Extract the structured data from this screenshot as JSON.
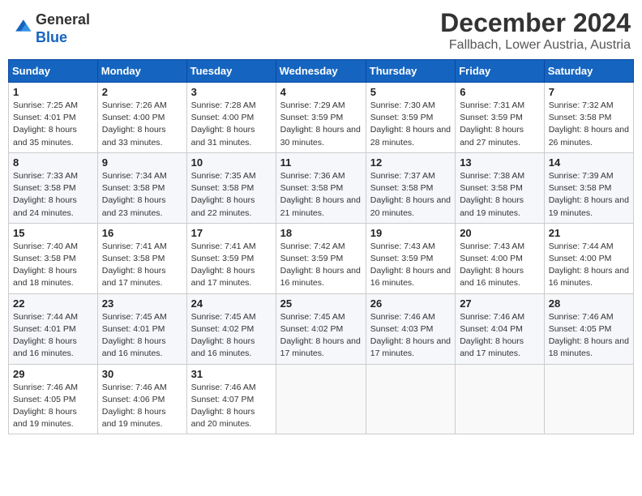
{
  "header": {
    "logo_line1": "General",
    "logo_line2": "Blue",
    "main_title": "December 2024",
    "subtitle": "Fallbach, Lower Austria, Austria"
  },
  "calendar": {
    "days_of_week": [
      "Sunday",
      "Monday",
      "Tuesday",
      "Wednesday",
      "Thursday",
      "Friday",
      "Saturday"
    ],
    "weeks": [
      [
        {
          "day": "1",
          "sunrise": "7:25 AM",
          "sunset": "4:01 PM",
          "daylight": "8 hours and 35 minutes."
        },
        {
          "day": "2",
          "sunrise": "7:26 AM",
          "sunset": "4:00 PM",
          "daylight": "8 hours and 33 minutes."
        },
        {
          "day": "3",
          "sunrise": "7:28 AM",
          "sunset": "4:00 PM",
          "daylight": "8 hours and 31 minutes."
        },
        {
          "day": "4",
          "sunrise": "7:29 AM",
          "sunset": "3:59 PM",
          "daylight": "8 hours and 30 minutes."
        },
        {
          "day": "5",
          "sunrise": "7:30 AM",
          "sunset": "3:59 PM",
          "daylight": "8 hours and 28 minutes."
        },
        {
          "day": "6",
          "sunrise": "7:31 AM",
          "sunset": "3:59 PM",
          "daylight": "8 hours and 27 minutes."
        },
        {
          "day": "7",
          "sunrise": "7:32 AM",
          "sunset": "3:58 PM",
          "daylight": "8 hours and 26 minutes."
        }
      ],
      [
        {
          "day": "8",
          "sunrise": "7:33 AM",
          "sunset": "3:58 PM",
          "daylight": "8 hours and 24 minutes."
        },
        {
          "day": "9",
          "sunrise": "7:34 AM",
          "sunset": "3:58 PM",
          "daylight": "8 hours and 23 minutes."
        },
        {
          "day": "10",
          "sunrise": "7:35 AM",
          "sunset": "3:58 PM",
          "daylight": "8 hours and 22 minutes."
        },
        {
          "day": "11",
          "sunrise": "7:36 AM",
          "sunset": "3:58 PM",
          "daylight": "8 hours and 21 minutes."
        },
        {
          "day": "12",
          "sunrise": "7:37 AM",
          "sunset": "3:58 PM",
          "daylight": "8 hours and 20 minutes."
        },
        {
          "day": "13",
          "sunrise": "7:38 AM",
          "sunset": "3:58 PM",
          "daylight": "8 hours and 19 minutes."
        },
        {
          "day": "14",
          "sunrise": "7:39 AM",
          "sunset": "3:58 PM",
          "daylight": "8 hours and 19 minutes."
        }
      ],
      [
        {
          "day": "15",
          "sunrise": "7:40 AM",
          "sunset": "3:58 PM",
          "daylight": "8 hours and 18 minutes."
        },
        {
          "day": "16",
          "sunrise": "7:41 AM",
          "sunset": "3:58 PM",
          "daylight": "8 hours and 17 minutes."
        },
        {
          "day": "17",
          "sunrise": "7:41 AM",
          "sunset": "3:59 PM",
          "daylight": "8 hours and 17 minutes."
        },
        {
          "day": "18",
          "sunrise": "7:42 AM",
          "sunset": "3:59 PM",
          "daylight": "8 hours and 16 minutes."
        },
        {
          "day": "19",
          "sunrise": "7:43 AM",
          "sunset": "3:59 PM",
          "daylight": "8 hours and 16 minutes."
        },
        {
          "day": "20",
          "sunrise": "7:43 AM",
          "sunset": "4:00 PM",
          "daylight": "8 hours and 16 minutes."
        },
        {
          "day": "21",
          "sunrise": "7:44 AM",
          "sunset": "4:00 PM",
          "daylight": "8 hours and 16 minutes."
        }
      ],
      [
        {
          "day": "22",
          "sunrise": "7:44 AM",
          "sunset": "4:01 PM",
          "daylight": "8 hours and 16 minutes."
        },
        {
          "day": "23",
          "sunrise": "7:45 AM",
          "sunset": "4:01 PM",
          "daylight": "8 hours and 16 minutes."
        },
        {
          "day": "24",
          "sunrise": "7:45 AM",
          "sunset": "4:02 PM",
          "daylight": "8 hours and 16 minutes."
        },
        {
          "day": "25",
          "sunrise": "7:45 AM",
          "sunset": "4:02 PM",
          "daylight": "8 hours and 17 minutes."
        },
        {
          "day": "26",
          "sunrise": "7:46 AM",
          "sunset": "4:03 PM",
          "daylight": "8 hours and 17 minutes."
        },
        {
          "day": "27",
          "sunrise": "7:46 AM",
          "sunset": "4:04 PM",
          "daylight": "8 hours and 17 minutes."
        },
        {
          "day": "28",
          "sunrise": "7:46 AM",
          "sunset": "4:05 PM",
          "daylight": "8 hours and 18 minutes."
        }
      ],
      [
        {
          "day": "29",
          "sunrise": "7:46 AM",
          "sunset": "4:05 PM",
          "daylight": "8 hours and 19 minutes."
        },
        {
          "day": "30",
          "sunrise": "7:46 AM",
          "sunset": "4:06 PM",
          "daylight": "8 hours and 19 minutes."
        },
        {
          "day": "31",
          "sunrise": "7:46 AM",
          "sunset": "4:07 PM",
          "daylight": "8 hours and 20 minutes."
        },
        null,
        null,
        null,
        null
      ]
    ]
  }
}
